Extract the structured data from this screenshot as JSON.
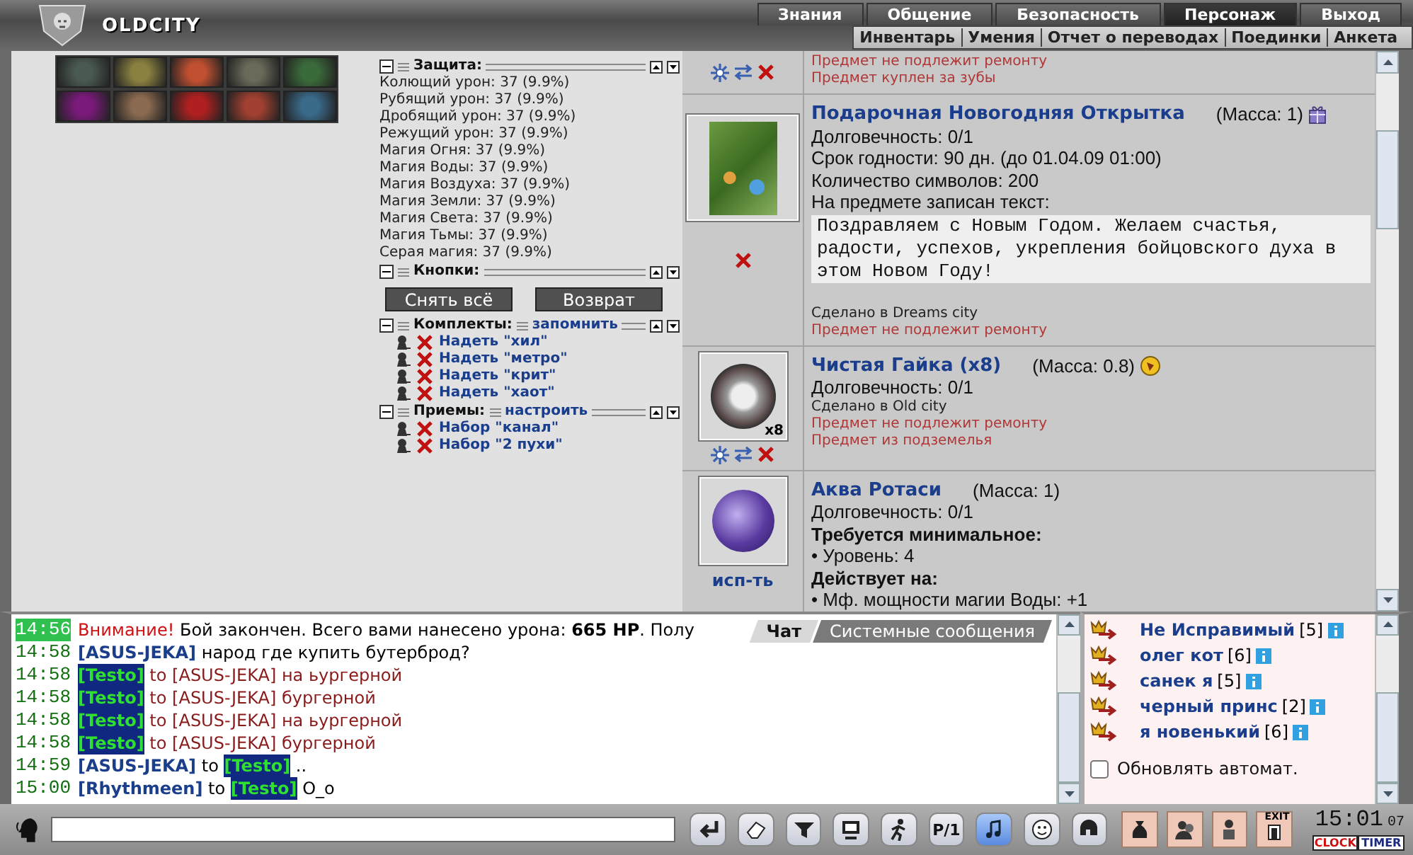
{
  "header": {
    "logo": "OLDCITY",
    "menu": [
      {
        "label": "Знания",
        "selected": false
      },
      {
        "label": "Общение",
        "selected": false
      },
      {
        "label": "Безопасность",
        "selected": false
      },
      {
        "label": "Персонаж",
        "selected": true
      },
      {
        "label": "Выход",
        "selected": false
      }
    ],
    "submenu": [
      "Инвентарь",
      "Умения",
      "Отчет о переводах",
      "Поединки",
      "Анкета"
    ]
  },
  "left_panel": {
    "sections": [
      {
        "kind": "stats",
        "title": "Защита:",
        "lines": [
          "Колющий урон: 37 (9.9%)",
          "Рубящий урон: 37 (9.9%)",
          "Дробящий урон: 37 (9.9%)",
          "Режущий урон: 37 (9.9%)",
          "Магия Огня: 37 (9.9%)",
          "Магия Воды: 37 (9.9%)",
          "Магия Воздуха: 37 (9.9%)",
          "Магия Земли: 37 (9.9%)",
          "Магия Света: 37 (9.9%)",
          "Магия Тьмы: 37 (9.9%)",
          "Серая магия: 37 (9.9%)"
        ]
      },
      {
        "kind": "buttons",
        "title": "Кнопки:",
        "buttons": [
          "Снять всё",
          "Возврат"
        ]
      },
      {
        "kind": "sets",
        "title": "Комплекты:",
        "link": "запомнить",
        "items": [
          "Надеть \"хил\"",
          "Надеть \"метро\"",
          "Надеть \"крит\"",
          "Надеть \"хаот\""
        ]
      },
      {
        "kind": "sets",
        "title": "Приемы:",
        "link": "настроить",
        "items": [
          "Набор \"канал\"",
          "Набор \"2 пухи\""
        ]
      }
    ]
  },
  "items": [
    {
      "actions": [
        {
          "kind": "gear"
        },
        {
          "kind": "swap"
        },
        {
          "kind": "delete"
        }
      ],
      "lines": [
        {
          "kind": "note",
          "text": "Предмет не подлежит ремонту"
        },
        {
          "kind": "note",
          "text": "Предмет куплен за зубы"
        }
      ]
    },
    {
      "picture": {
        "kind": "card"
      },
      "actions": [
        {
          "kind": "delete"
        }
      ],
      "title": "Подарочная Новогодняя Открытка",
      "mass": "(Масса: 1)",
      "badge": {
        "kind": "gift"
      },
      "lines": [
        {
          "kind": "text",
          "text": "Долговечность: 0/1"
        },
        {
          "kind": "text",
          "text": "Срок годности: 90 дн. (до 01.04.09 01:00)"
        },
        {
          "kind": "text",
          "text": "Количество символов: 200"
        },
        {
          "kind": "text",
          "text": "На предмете записан текст:"
        },
        {
          "kind": "inscription",
          "text": "Поздравляем с Новым Годом. Желаем счастья, радости, успехов, укрепления бойцовского духа в этом Новом Году!"
        },
        {
          "kind": "small",
          "text": "Сделано в Dreams city"
        },
        {
          "kind": "note",
          "text": "Предмет не подлежит ремонту"
        }
      ]
    },
    {
      "picture": {
        "kind": "nut"
      },
      "count": "x8",
      "actions": [
        {
          "kind": "gear"
        },
        {
          "kind": "swap"
        },
        {
          "kind": "delete"
        }
      ],
      "title": "Чистая Гайка (x8)",
      "mass": "(Масса: 0.8)",
      "badge": {
        "kind": "coin"
      },
      "lines": [
        {
          "kind": "text",
          "text": "Долговечность: 0/1"
        },
        {
          "kind": "small",
          "text": "Сделано в Old city"
        },
        {
          "kind": "note",
          "text": "Предмет не подлежит ремонту"
        },
        {
          "kind": "note",
          "text": "Предмет из подземелья"
        }
      ]
    },
    {
      "picture": {
        "kind": "gem"
      },
      "use_link": "исп-ть",
      "title": "Аква Ротаси",
      "mass": "(Масса: 1)",
      "lines": [
        {
          "kind": "text",
          "text": "Долговечность: 0/1"
        },
        {
          "kind": "heading",
          "text": "Требуется минимальное:"
        },
        {
          "kind": "text",
          "text": "• Уровень: 4"
        },
        {
          "kind": "heading",
          "text": "Действует на:"
        },
        {
          "kind": "text",
          "text": "• Мф. мощности магии Воды: +1"
        }
      ]
    }
  ],
  "chat": {
    "tabs": [
      {
        "label": "Чат",
        "selected": true
      },
      {
        "label": "Системные сообщения",
        "selected": false
      }
    ],
    "messages": [
      {
        "time": "14:56",
        "time_highlight": true,
        "kind": "system",
        "label": "Внимание!",
        "text": "Бой закончен. Всего вами нанесено урона: **665 HP**. Полу"
      },
      {
        "time": "14:58",
        "time_highlight": false,
        "kind": "public",
        "from": {
          "name": "[ASUS-JEKA]",
          "highlight": false
        },
        "text": "народ где купить бутерброд?"
      },
      {
        "time": "14:58",
        "time_highlight": false,
        "kind": "outgoing",
        "from": {
          "name": "[Testo]",
          "highlight": true
        },
        "to": "to",
        "recipient": {
          "name": "[ASUS-JEKA]",
          "highlight": false
        },
        "text": "на ьургерной"
      },
      {
        "time": "14:58",
        "time_highlight": false,
        "kind": "outgoing",
        "from": {
          "name": "[Testo]",
          "highlight": true
        },
        "to": "to",
        "recipient": {
          "name": "[ASUS-JEKA]",
          "highlight": false
        },
        "text": "бургерной"
      },
      {
        "time": "14:58",
        "time_highlight": false,
        "kind": "outgoing",
        "from": {
          "name": "[Testo]",
          "highlight": true
        },
        "to": "to",
        "recipient": {
          "name": "[ASUS-JEKA]",
          "highlight": false
        },
        "text": "на ьургерной"
      },
      {
        "time": "14:58",
        "time_highlight": false,
        "kind": "outgoing",
        "from": {
          "name": "[Testo]",
          "highlight": true
        },
        "to": "to",
        "recipient": {
          "name": "[ASUS-JEKA]",
          "highlight": false
        },
        "text": "бургерной"
      },
      {
        "time": "14:59",
        "time_highlight": false,
        "kind": "incoming",
        "from": {
          "name": "[ASUS-JEKA]",
          "highlight": false
        },
        "to": "to",
        "recipient": {
          "name": "[Testo]",
          "highlight": true
        },
        "text": ".."
      },
      {
        "time": "15:00",
        "time_highlight": false,
        "kind": "incoming",
        "from": {
          "name": "[Rhythmeen]",
          "highlight": false
        },
        "to": "to",
        "recipient": {
          "name": "[Testo]",
          "highlight": true
        },
        "text": "O_o"
      }
    ]
  },
  "online": {
    "users": [
      {
        "name": "Не Исправимый",
        "rank": "[5]"
      },
      {
        "name": "олег кот",
        "rank": "[6]"
      },
      {
        "name": "санек я",
        "rank": "[5]"
      },
      {
        "name": "черный принс",
        "rank": "[2]"
      },
      {
        "name": "я новенький",
        "rank": "[6]"
      }
    ],
    "auto_refresh": {
      "label": "Обновлять автомат.",
      "checked": false
    }
  },
  "toolbar": {
    "tools": [
      {
        "kind": "eraser",
        "selected": false
      },
      {
        "kind": "filter",
        "selected": false
      },
      {
        "kind": "monitor",
        "selected": false
      },
      {
        "kind": "runner",
        "selected": false
      },
      {
        "kind": "text",
        "label": "P/1",
        "selected": false
      },
      {
        "kind": "music",
        "selected": true
      },
      {
        "kind": "smile",
        "selected": false
      },
      {
        "kind": "helmet",
        "selected": false
      }
    ],
    "right_tools": [
      {
        "kind": "bag"
      },
      {
        "kind": "people"
      },
      {
        "kind": "person"
      },
      {
        "kind": "exit",
        "label": "EXIT"
      }
    ],
    "clock": {
      "time": "15:01",
      "seconds": "07",
      "buttons": [
        "CLOCK",
        "TIMER"
      ]
    }
  }
}
